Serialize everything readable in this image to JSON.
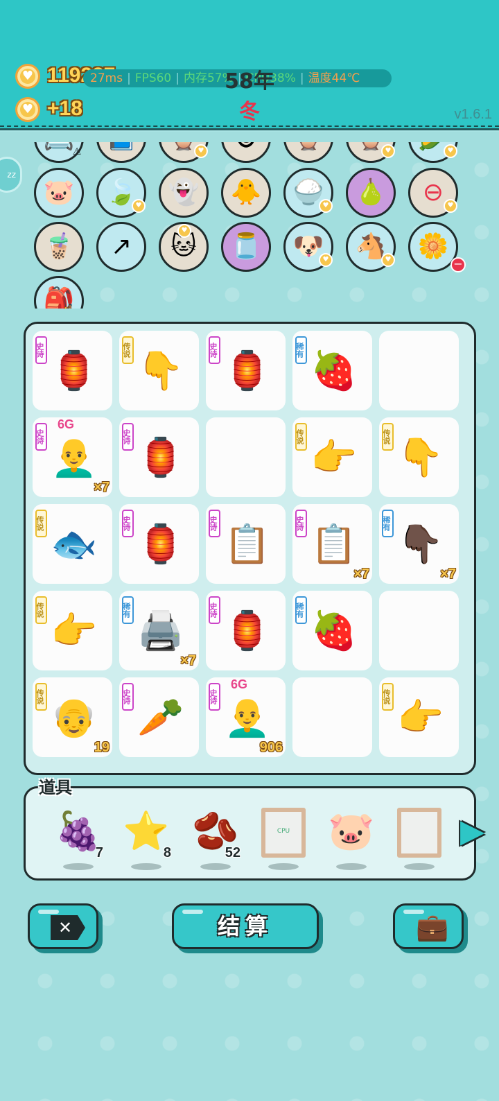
{
  "header": {
    "coins": "119227",
    "income": "+18",
    "year": "58年",
    "season": "冬",
    "version": "v1.6.1",
    "perf": {
      "latency": "27ms",
      "fps": "FPS60",
      "memory": "内存57%",
      "cpu": "CPU38%",
      "temperature": "温度44℃"
    }
  },
  "side_badge": "zz",
  "item_circles": [
    {
      "icon": "📇"
    },
    {
      "icon": "📘"
    },
    {
      "icon": "🦉"
    },
    {
      "icon": "🐵"
    },
    {
      "icon": "🦉"
    },
    {
      "icon": "🦉"
    },
    {
      "icon": "🌽"
    },
    {
      "icon": "🐷"
    },
    {
      "icon": "🍃"
    },
    {
      "icon": "👻"
    },
    {
      "icon": "🐥"
    },
    {
      "icon": "🍚"
    },
    {
      "icon": "🍐"
    },
    {
      "icon": "⊖"
    },
    {
      "icon": "🧋"
    },
    {
      "icon": "↗"
    },
    {
      "icon": "🐱"
    },
    {
      "icon": "🫙"
    },
    {
      "icon": "🐶"
    },
    {
      "icon": "🐴"
    },
    {
      "icon": "🌼"
    },
    {
      "icon": "🎒"
    }
  ],
  "grid": [
    {
      "tag": "史诗",
      "rarity": "epic",
      "icon": "🏮",
      "count": ""
    },
    {
      "tag": "传说",
      "rarity": "legend",
      "icon": "👇",
      "count": ""
    },
    {
      "tag": "史诗",
      "rarity": "epic",
      "icon": "🏮",
      "count": ""
    },
    {
      "tag": "稀有",
      "rarity": "rare",
      "icon": "🍓",
      "count": ""
    },
    {
      "tag": "",
      "rarity": "",
      "icon": "",
      "count": ""
    },
    {
      "tag": "史诗",
      "rarity": "epic",
      "icon": "👨‍🦲",
      "count": "×7",
      "over": "6G"
    },
    {
      "tag": "史诗",
      "rarity": "epic",
      "icon": "🏮",
      "count": ""
    },
    {
      "tag": "",
      "rarity": "",
      "icon": "",
      "count": ""
    },
    {
      "tag": "传说",
      "rarity": "legend",
      "icon": "👉",
      "count": ""
    },
    {
      "tag": "传说",
      "rarity": "legend",
      "icon": "👇",
      "count": ""
    },
    {
      "tag": "传说",
      "rarity": "legend",
      "icon": "🐟",
      "count": ""
    },
    {
      "tag": "史诗",
      "rarity": "epic",
      "icon": "🏮",
      "count": ""
    },
    {
      "tag": "史诗",
      "rarity": "epic",
      "icon": "📋",
      "count": ""
    },
    {
      "tag": "史诗",
      "rarity": "epic",
      "icon": "📋",
      "count": "×7"
    },
    {
      "tag": "稀有",
      "rarity": "rare",
      "icon": "👇🏿",
      "count": "×7"
    },
    {
      "tag": "传说",
      "rarity": "legend",
      "icon": "👉",
      "count": ""
    },
    {
      "tag": "稀有",
      "rarity": "rare",
      "icon": "🖨️",
      "count": "×7"
    },
    {
      "tag": "史诗",
      "rarity": "epic",
      "icon": "🏮",
      "count": ""
    },
    {
      "tag": "稀有",
      "rarity": "rare",
      "icon": "🍓",
      "count": ""
    },
    {
      "tag": "",
      "rarity": "",
      "icon": "",
      "count": ""
    },
    {
      "tag": "传说",
      "rarity": "legend",
      "icon": "👴",
      "count": "19"
    },
    {
      "tag": "史诗",
      "rarity": "epic",
      "icon": "🥕",
      "count": ""
    },
    {
      "tag": "史诗",
      "rarity": "epic",
      "icon": "👨‍🦲",
      "count": "906",
      "over": "6G"
    },
    {
      "tag": "",
      "rarity": "",
      "icon": "",
      "count": ""
    },
    {
      "tag": "传说",
      "rarity": "legend",
      "icon": "👉",
      "count": ""
    }
  ],
  "props": {
    "title": "道具",
    "items": [
      {
        "icon": "🍇",
        "count": "7"
      },
      {
        "icon": "⭐",
        "count": "8"
      },
      {
        "icon": "🫘",
        "count": "52"
      },
      {
        "icon": "cpu-frame",
        "count": ""
      },
      {
        "icon": "🐷",
        "count": ""
      },
      {
        "icon": "empty-frame",
        "count": ""
      }
    ],
    "next_arrow": "▶"
  },
  "buttons": {
    "settle": "结算",
    "close_glyph": "✕",
    "bag_glyph": "💼"
  },
  "colors": {
    "topbar": "#2ec6c6",
    "background": "#a2dede",
    "epic": "#cc45c8",
    "legend": "#e8bd2b",
    "rare": "#3d97d8",
    "coin": "#f7c64c"
  }
}
